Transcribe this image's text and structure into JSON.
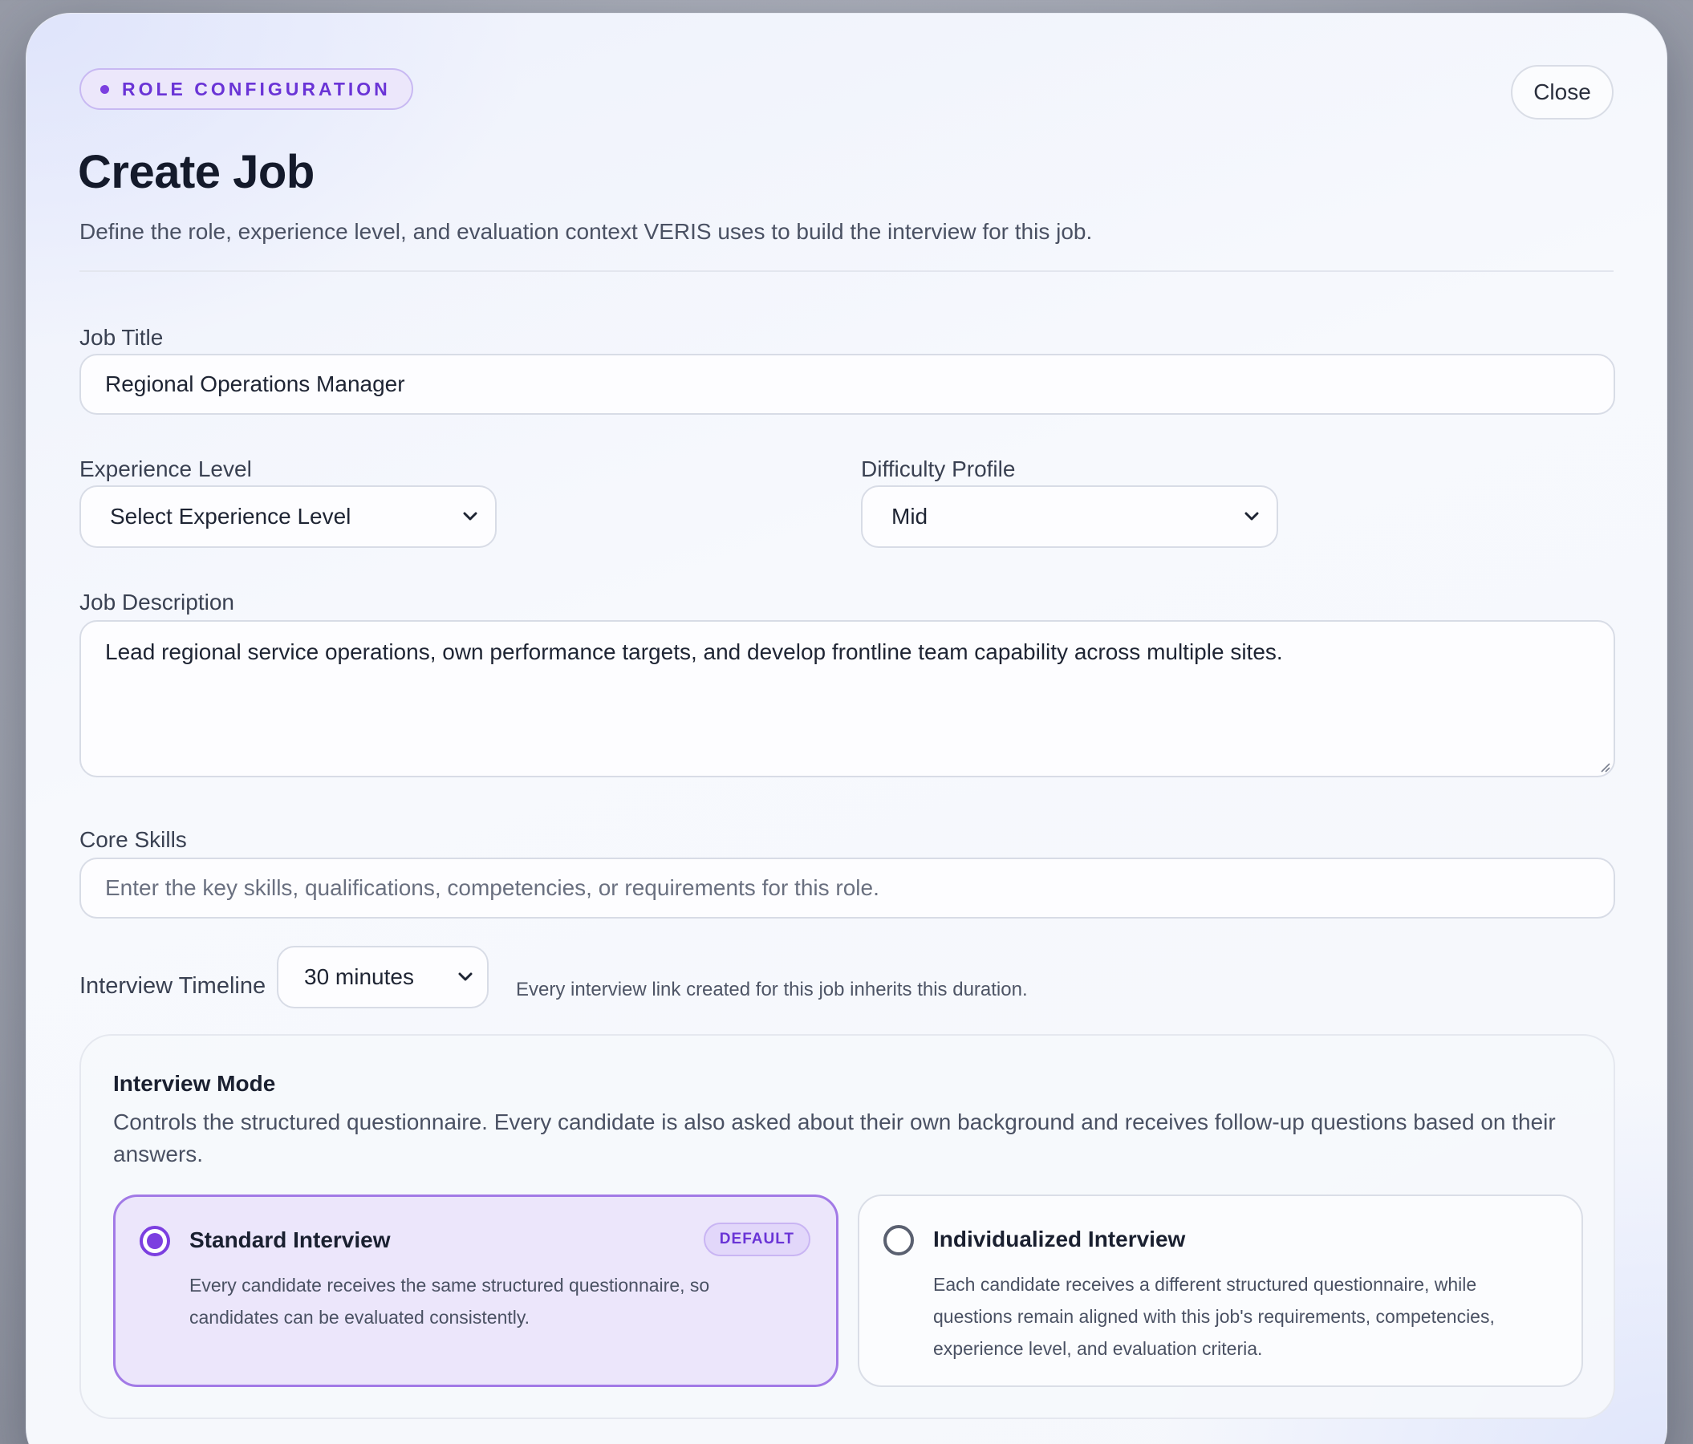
{
  "header": {
    "badge": "ROLE CONFIGURATION",
    "title": "Create Job",
    "subtitle": "Define the role, experience level, and evaluation context VERIS uses to build the interview for this job.",
    "close_label": "Close"
  },
  "form": {
    "job_title": {
      "label": "Job Title",
      "value": "Regional Operations Manager"
    },
    "experience_level": {
      "label": "Experience Level",
      "value": "Select Experience Level"
    },
    "difficulty_profile": {
      "label": "Difficulty Profile",
      "value": "Mid"
    },
    "job_description": {
      "label": "Job Description",
      "value": "Lead regional service operations, own performance targets, and develop frontline team capability across multiple sites."
    },
    "core_skills": {
      "label": "Core Skills",
      "placeholder": "Enter the key skills, qualifications, competencies, or requirements for this role."
    },
    "timeline": {
      "label": "Interview Timeline",
      "value": "30 minutes",
      "hint": "Every interview link created for this job inherits this duration."
    }
  },
  "interview_mode": {
    "title": "Interview Mode",
    "description": "Controls the structured questionnaire. Every candidate is also asked about their own background and receives follow-up questions based on their answers.",
    "options": [
      {
        "title": "Standard Interview",
        "badge": "DEFAULT",
        "selected": true,
        "description": "Every candidate receives the same structured questionnaire, so candidates can be evaluated consistently."
      },
      {
        "title": "Individualized Interview",
        "selected": false,
        "description": "Each candidate receives a different structured questionnaire, while questions remain aligned with this job's requirements, competencies, experience level, and evaluation criteria."
      }
    ]
  },
  "colors": {
    "accent": "#7c3fe0",
    "accent_soft": "#ece6fb"
  },
  "icons": {
    "select": "chevron-down-icon",
    "radio_on": "radio-selected-icon",
    "radio_off": "radio-unselected-icon"
  }
}
